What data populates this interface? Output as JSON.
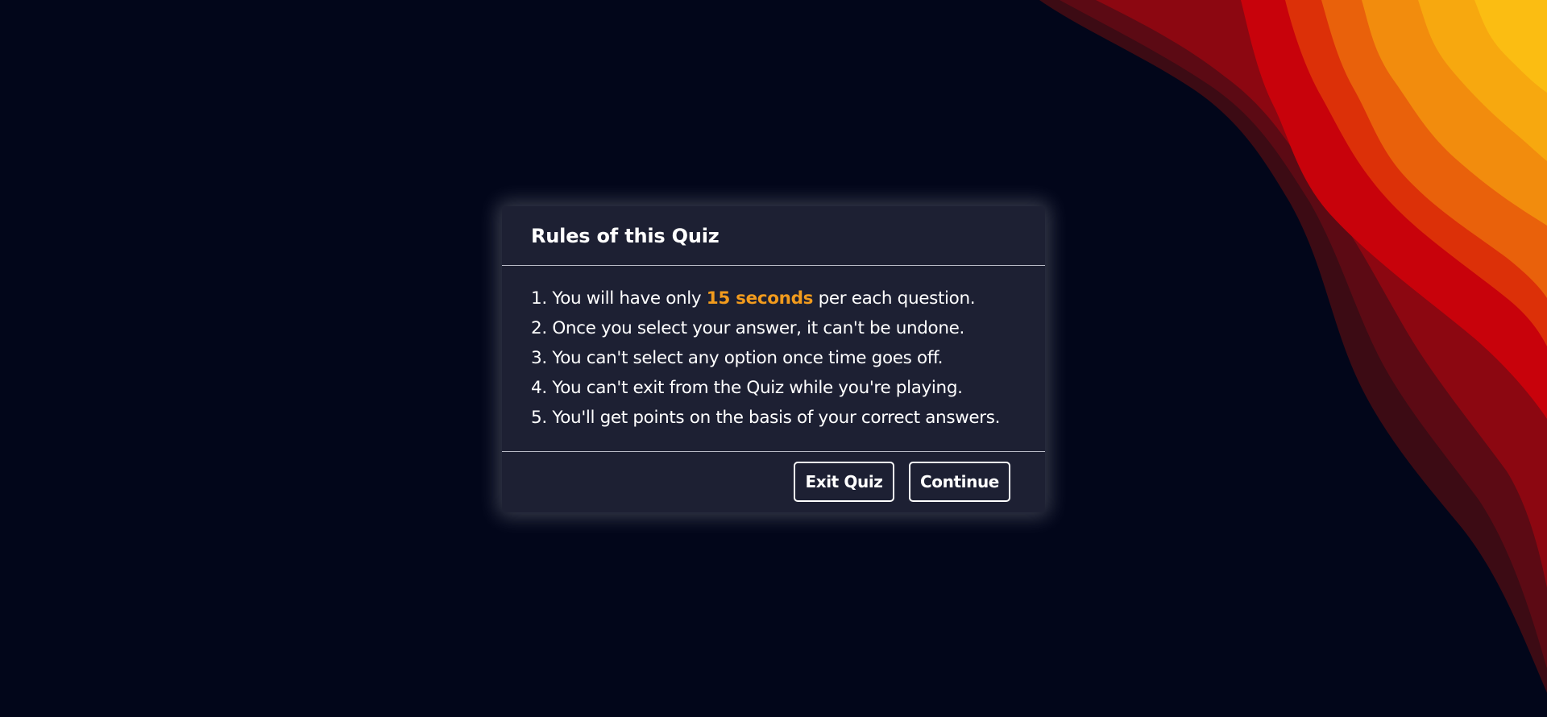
{
  "colors": {
    "background": "#02061a",
    "card": "#1d2033",
    "accent": "#f29b1d",
    "text": "#ffffff"
  },
  "rules_box": {
    "title": "Rules of this Quiz",
    "rules": [
      {
        "number": "1.",
        "before": "You will have only",
        "highlight": "15 seconds",
        "after": "per each question."
      },
      {
        "number": "2.",
        "text": "Once you select your answer, it can't be undone."
      },
      {
        "number": "3.",
        "text": "You can't select any option once time goes off."
      },
      {
        "number": "4.",
        "text": "You can't exit from the Quiz while you're playing."
      },
      {
        "number": "5.",
        "text": "You'll get points on the basis of your correct answers."
      }
    ],
    "buttons": {
      "exit_label": "Exit Quiz",
      "continue_label": "Continue"
    }
  }
}
